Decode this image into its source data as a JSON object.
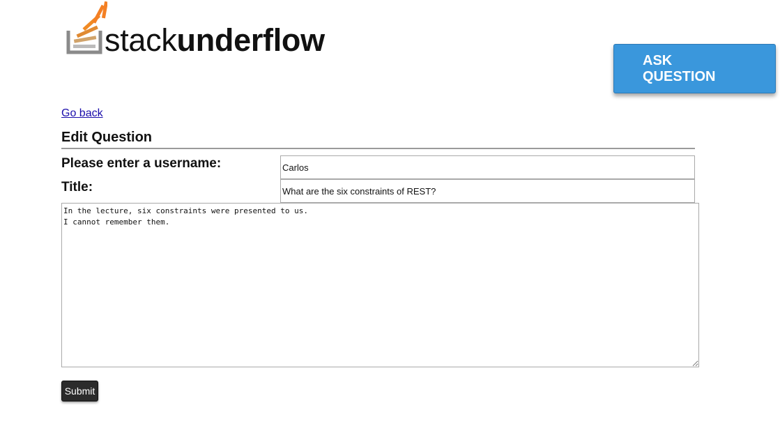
{
  "brand": {
    "name_light": "stack",
    "name_bold": "underflow",
    "logo_icon": "stack-tray-icon",
    "colors": {
      "logo_orange": "#f48024",
      "logo_tray": "#8a8a8a"
    }
  },
  "header": {
    "ask_button_label": "ASK QUESTION",
    "ask_button_color": "#3a97dc"
  },
  "nav": {
    "go_back": "Go back"
  },
  "form": {
    "heading": "Edit Question",
    "username_label": "Please enter a username:",
    "username_value": "Carlos",
    "title_label": "Title:",
    "title_value": "What are the six constraints of REST?",
    "body_value": "In the lecture, six constraints were presented to us.\nI cannot remember them.",
    "submit_label": "Submit"
  }
}
